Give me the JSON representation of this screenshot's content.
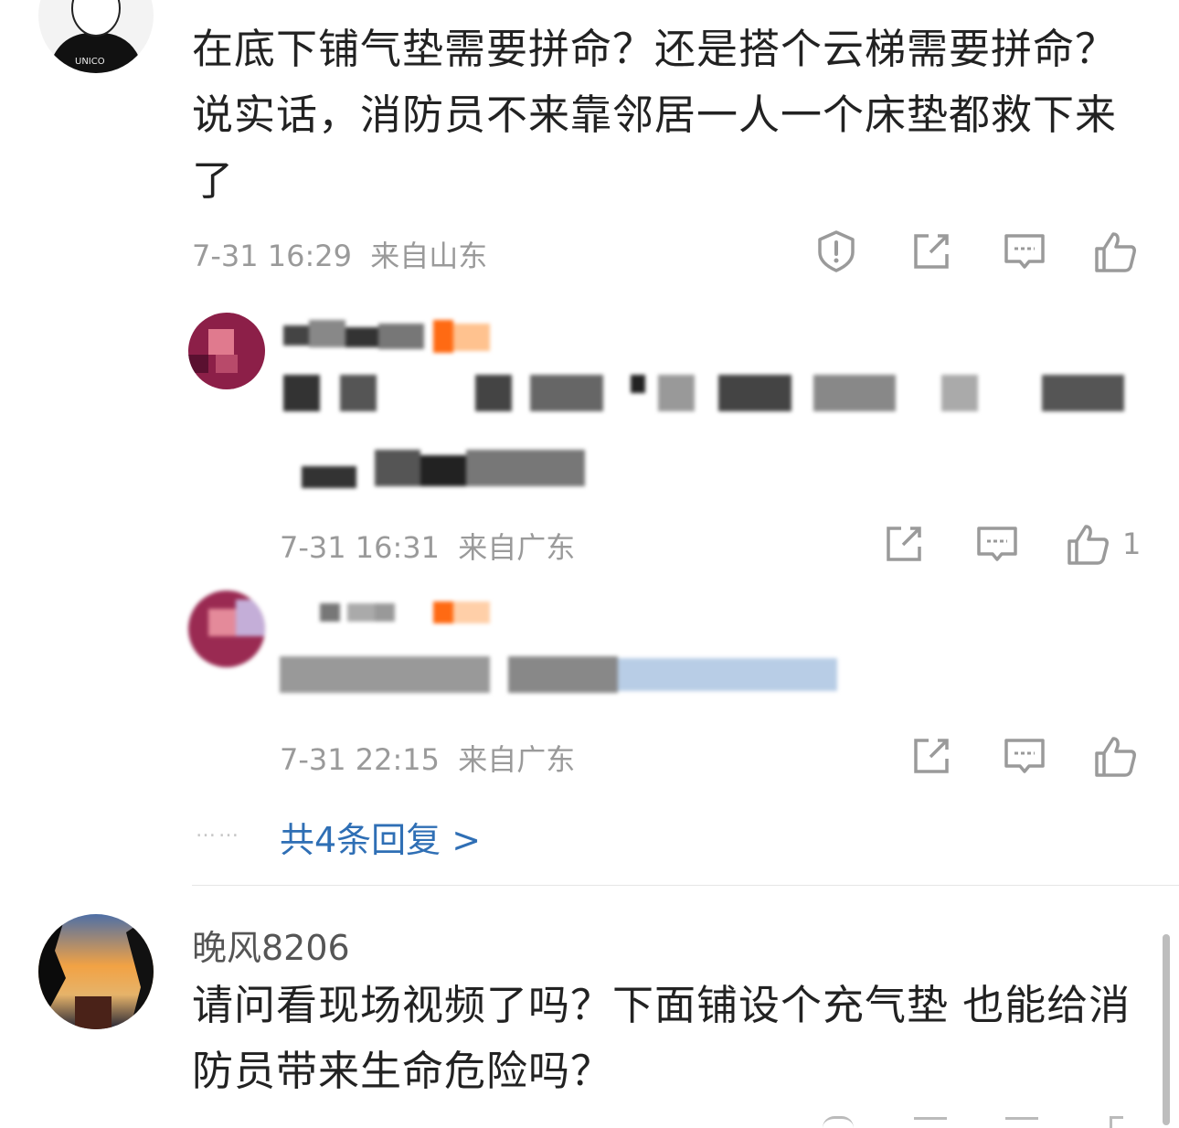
{
  "comment1": {
    "text": "在底下铺气垫需要拼命？还是搭个云梯需要拼命？说实话，消防员不来靠邻居一人一个床垫都救下来了",
    "time": "7-31 16:29",
    "location": "来自山东"
  },
  "reply1": {
    "text_partial": "嘅 那",
    "text_partial2": "贵呢？",
    "time": "7-31 16:31",
    "location": "来自广东",
    "like_count": "1"
  },
  "reply2": {
    "time": "7-31 22:15",
    "location": "来自广东"
  },
  "replies_summary": {
    "dots": "……",
    "label": "共4条回复 >"
  },
  "comment2": {
    "username": "晚风8206",
    "text": "请问看现场视频了吗？下面铺设个充气垫 也能给消防员带来生命危险吗？"
  },
  "icons": [
    "report-icon",
    "share-icon",
    "comment-icon",
    "like-icon"
  ],
  "colors": {
    "link": "#2f6fb5",
    "meta": "#9a9a9a",
    "text": "#222222",
    "badge": "#ff6a13"
  }
}
